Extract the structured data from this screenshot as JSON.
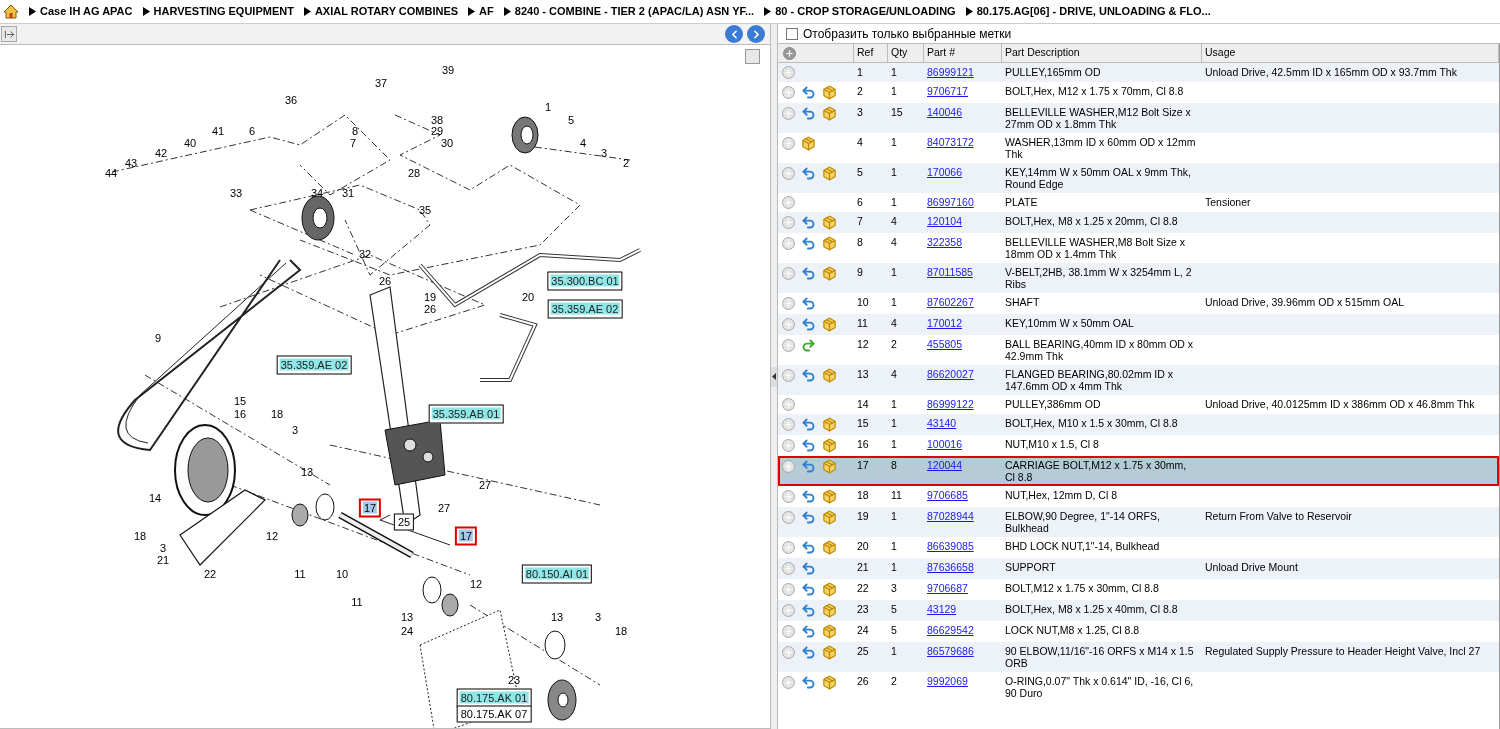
{
  "breadcrumb": [
    "Case IH AG APAC",
    "HARVESTING EQUIPMENT",
    "AXIAL ROTARY COMBINES",
    "AF",
    "8240 - COMBINE - TIER 2 (APAC/LA) ASN YF...",
    "80 - CROP STORAGE/UNLOADING",
    "80.175.AG[06] - DRIVE, UNLOADING & FLO..."
  ],
  "filter": {
    "label": "Отобразить только выбранные метки",
    "checked": false
  },
  "callouts": [
    {
      "text": "39",
      "kind": "number"
    },
    {
      "text": "37",
      "kind": "number"
    },
    {
      "text": "36",
      "kind": "number"
    },
    {
      "text": "1",
      "kind": "number"
    },
    {
      "text": "38",
      "kind": "number"
    },
    {
      "text": "5",
      "kind": "number"
    },
    {
      "text": "41",
      "kind": "number"
    },
    {
      "text": "6",
      "kind": "number"
    },
    {
      "text": "8",
      "kind": "number"
    },
    {
      "text": "29",
      "kind": "number"
    },
    {
      "text": "40",
      "kind": "number"
    },
    {
      "text": "7",
      "kind": "number"
    },
    {
      "text": "30",
      "kind": "number"
    },
    {
      "text": "4",
      "kind": "number"
    },
    {
      "text": "42",
      "kind": "number"
    },
    {
      "text": "3",
      "kind": "number"
    },
    {
      "text": "43",
      "kind": "number"
    },
    {
      "text": "2",
      "kind": "number"
    },
    {
      "text": "44",
      "kind": "number"
    },
    {
      "text": "28",
      "kind": "number"
    },
    {
      "text": "33",
      "kind": "number"
    },
    {
      "text": "34",
      "kind": "number"
    },
    {
      "text": "31",
      "kind": "number"
    },
    {
      "text": "35",
      "kind": "number"
    },
    {
      "text": "32",
      "kind": "number"
    },
    {
      "text": "26",
      "kind": "number"
    },
    {
      "text": "35.300.BC 01",
      "kind": "ref"
    },
    {
      "text": "19",
      "kind": "number"
    },
    {
      "text": "20",
      "kind": "number"
    },
    {
      "text": "26",
      "kind": "number"
    },
    {
      "text": "35.359.AE 02",
      "kind": "ref"
    },
    {
      "text": "9",
      "kind": "number"
    },
    {
      "text": "35.359.AE 02",
      "kind": "ref"
    },
    {
      "text": "15",
      "kind": "number"
    },
    {
      "text": "16",
      "kind": "number"
    },
    {
      "text": "18",
      "kind": "number"
    },
    {
      "text": "35.359.AB 01",
      "kind": "ref"
    },
    {
      "text": "3",
      "kind": "number"
    },
    {
      "text": "13",
      "kind": "number"
    },
    {
      "text": "27",
      "kind": "number"
    },
    {
      "text": "14",
      "kind": "number"
    },
    {
      "text": "17",
      "kind": "highlighted"
    },
    {
      "text": "27",
      "kind": "number"
    },
    {
      "text": "25",
      "kind": "boxed"
    },
    {
      "text": "18",
      "kind": "number"
    },
    {
      "text": "12",
      "kind": "number"
    },
    {
      "text": "17",
      "kind": "highlighted"
    },
    {
      "text": "3",
      "kind": "number"
    },
    {
      "text": "21",
      "kind": "number"
    },
    {
      "text": "22",
      "kind": "number"
    },
    {
      "text": "11",
      "kind": "number"
    },
    {
      "text": "10",
      "kind": "number"
    },
    {
      "text": "80.150.AI 01",
      "kind": "ref"
    },
    {
      "text": "12",
      "kind": "number"
    },
    {
      "text": "11",
      "kind": "number"
    },
    {
      "text": "13",
      "kind": "number"
    },
    {
      "text": "13",
      "kind": "number"
    },
    {
      "text": "3",
      "kind": "number"
    },
    {
      "text": "24",
      "kind": "number"
    },
    {
      "text": "18",
      "kind": "number"
    },
    {
      "text": "23",
      "kind": "number"
    },
    {
      "text": "80.175.AK 01",
      "kind": "ref"
    },
    {
      "text": "80.175.AK 07",
      "kind": "boxed"
    }
  ],
  "table": {
    "columns": [
      "Ref",
      "Qty",
      "Part #",
      "Part Description",
      "Usage"
    ],
    "rows": [
      {
        "kind": "none",
        "ref": "1",
        "qty": "1",
        "part": "86999121",
        "description": "PULLEY,165mm OD",
        "usage": "Unload Drive, 42.5mm ID x 165mm OD x 93.7mm Thk",
        "selected": false
      },
      {
        "kind": "stock",
        "ref": "2",
        "qty": "1",
        "part": "9706717",
        "description": "BOLT,Hex, M12 x 1.75 x 70mm, Cl 8.8",
        "usage": "",
        "selected": false
      },
      {
        "kind": "stock",
        "ref": "3",
        "qty": "15",
        "part": "140046",
        "description": "BELLEVILLE WASHER,M12 Bolt Size x 27mm OD x 1.8mm Thk",
        "usage": "",
        "selected": false
      },
      {
        "kind": "box",
        "ref": "4",
        "qty": "1",
        "part": "84073172",
        "description": "WASHER,13mm ID x 60mm OD x 12mm Thk",
        "usage": "",
        "selected": false
      },
      {
        "kind": "stock",
        "ref": "5",
        "qty": "1",
        "part": "170066",
        "description": "KEY,14mm W x 50mm OAL x 9mm Thk, Round Edge",
        "usage": "",
        "selected": false
      },
      {
        "kind": "none",
        "ref": "6",
        "qty": "1",
        "part": "86997160",
        "description": "PLATE",
        "usage": "Tensioner",
        "selected": false
      },
      {
        "kind": "stock",
        "ref": "7",
        "qty": "4",
        "part": "120104",
        "description": "BOLT,Hex, M8 x 1.25 x 20mm, Cl 8.8",
        "usage": "",
        "selected": false
      },
      {
        "kind": "stock",
        "ref": "8",
        "qty": "4",
        "part": "322358",
        "description": "BELLEVILLE WASHER,M8 Bolt Size x 18mm OD x 1.4mm Thk",
        "usage": "",
        "selected": false
      },
      {
        "kind": "stock",
        "ref": "9",
        "qty": "1",
        "part": "87011585",
        "description": "V-BELT,2HB, 38.1mm W x 3254mm L, 2 Ribs",
        "usage": "",
        "selected": false
      },
      {
        "kind": "return",
        "ref": "10",
        "qty": "1",
        "part": "87602267",
        "description": "SHAFT",
        "usage": "Unload Drive, 39.96mm OD x 515mm OAL",
        "selected": false
      },
      {
        "kind": "stock",
        "ref": "11",
        "qty": "4",
        "part": "170012",
        "description": "KEY,10mm W x 50mm OAL",
        "usage": "",
        "selected": false
      },
      {
        "kind": "forward",
        "ref": "12",
        "qty": "2",
        "part": "455805",
        "description": "BALL BEARING,40mm ID x 80mm OD x 42.9mm Thk",
        "usage": "",
        "selected": false
      },
      {
        "kind": "stock",
        "ref": "13",
        "qty": "4",
        "part": "86620027",
        "description": "FLANGED BEARING,80.02mm ID x 147.6mm OD x 4mm Thk",
        "usage": "",
        "selected": false
      },
      {
        "kind": "none",
        "ref": "14",
        "qty": "1",
        "part": "86999122",
        "description": "PULLEY,386mm OD",
        "usage": "Unload Drive, 40.0125mm ID x 386mm OD x 46.8mm Thk",
        "selected": false
      },
      {
        "kind": "stock",
        "ref": "15",
        "qty": "1",
        "part": "43140",
        "description": "BOLT,Hex, M10 x 1.5 x 30mm, Cl 8.8",
        "usage": "",
        "selected": false
      },
      {
        "kind": "stock",
        "ref": "16",
        "qty": "1",
        "part": "100016",
        "description": "NUT,M10 x 1.5, Cl 8",
        "usage": "",
        "selected": false
      },
      {
        "kind": "stock",
        "ref": "17",
        "qty": "8",
        "part": "120044",
        "description": "CARRIAGE BOLT,M12 x 1.75 x 30mm, Cl 8.8",
        "usage": "",
        "selected": true
      },
      {
        "kind": "stock",
        "ref": "18",
        "qty": "11",
        "part": "9706685",
        "description": "NUT,Hex, 12mm D, Cl 8",
        "usage": "",
        "selected": false
      },
      {
        "kind": "stock",
        "ref": "19",
        "qty": "1",
        "part": "87028944",
        "description": "ELBOW,90 Degree, 1\"-14 ORFS, Bulkhead",
        "usage": "Return From Valve to Reservoir",
        "selected": false
      },
      {
        "kind": "stock",
        "ref": "20",
        "qty": "1",
        "part": "86639085",
        "description": "BHD LOCK NUT,1\"-14, Bulkhead",
        "usage": "",
        "selected": false
      },
      {
        "kind": "return",
        "ref": "21",
        "qty": "1",
        "part": "87636658",
        "description": "SUPPORT",
        "usage": "Unload Drive Mount",
        "selected": false
      },
      {
        "kind": "stock",
        "ref": "22",
        "qty": "3",
        "part": "9706687",
        "description": "BOLT,M12 x 1.75 x 30mm, Cl 8.8",
        "usage": "",
        "selected": false
      },
      {
        "kind": "stock",
        "ref": "23",
        "qty": "5",
        "part": "43129",
        "description": "BOLT,Hex, M8 x 1.25 x 40mm, Cl 8.8",
        "usage": "",
        "selected": false
      },
      {
        "kind": "stock",
        "ref": "24",
        "qty": "5",
        "part": "86629542",
        "description": "LOCK NUT,M8 x 1.25, Cl 8.8",
        "usage": "",
        "selected": false
      },
      {
        "kind": "stock",
        "ref": "25",
        "qty": "1",
        "part": "86579686",
        "description": "90 ELBOW,11/16\"-16 ORFS x M14 x 1.5 ORB",
        "usage": "Regulated Supply Pressure to Header Height Valve, Incl 27",
        "selected": false
      },
      {
        "kind": "stock",
        "ref": "26",
        "qty": "2",
        "part": "9992069",
        "description": "O-RING,0.07\" Thk x 0.614\" ID, -16, Cl 6, 90 Duro",
        "usage": "",
        "selected": false
      }
    ]
  }
}
